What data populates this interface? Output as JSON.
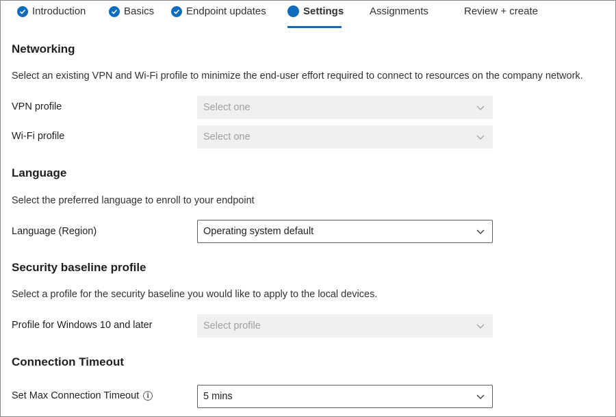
{
  "tabs": [
    {
      "label": "Introduction",
      "state": "complete"
    },
    {
      "label": "Basics",
      "state": "complete"
    },
    {
      "label": "Endpoint updates",
      "state": "complete"
    },
    {
      "label": "Settings",
      "state": "current"
    },
    {
      "label": "Assignments",
      "state": "pending"
    },
    {
      "label": "Review + create",
      "state": "pending"
    }
  ],
  "networking": {
    "title": "Networking",
    "description": "Select an existing VPN and Wi-Fi profile to minimize the end-user effort required to connect to resources on the company network.",
    "vpn": {
      "label": "VPN profile",
      "placeholder": "Select one",
      "disabled": true
    },
    "wifi": {
      "label": "Wi-Fi profile",
      "placeholder": "Select one",
      "disabled": true
    }
  },
  "language": {
    "title": "Language",
    "description": "Select the preferred language to enroll to your endpoint",
    "region": {
      "label": "Language (Region)",
      "value": "Operating system default"
    }
  },
  "security": {
    "title": "Security baseline profile",
    "description": "Select a profile for the security baseline you would like to apply to the local devices.",
    "profile": {
      "label": "Profile for Windows 10 and later",
      "placeholder": "Select profile",
      "disabled": true
    }
  },
  "timeout": {
    "title": "Connection Timeout",
    "max": {
      "label": "Set Max Connection Timeout",
      "value": "5 mins"
    }
  },
  "colors": {
    "accent": "#0f6cbd",
    "disabled_bg": "#f0f0f0",
    "disabled_text": "#a19f9d"
  },
  "icons": {
    "complete": "checkmark-circle-icon",
    "current": "filled-circle-icon",
    "dropdown": "chevron-down-icon",
    "info": "info-icon"
  }
}
